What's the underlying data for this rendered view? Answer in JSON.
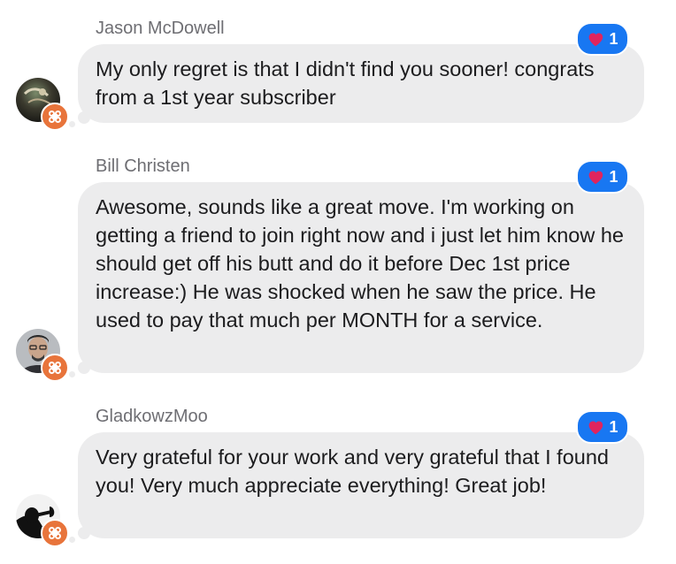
{
  "comments": [
    {
      "author": "Jason McDowell",
      "text": "My only regret is that I didn't find you sooner! congrats from a 1st year subscriber",
      "reaction": {
        "icon": "heart-icon",
        "count": "1"
      },
      "avatar": "avatar-dark-landscape",
      "badge": "app-badge-icon"
    },
    {
      "author": "Bill Christen",
      "text": "Awesome, sounds like a great move. I'm working on getting a friend to join right now and i just let him know he should get off his butt and do it before Dec 1st price increase:) He was shocked when he saw the price. He used to pay that much per MONTH for a service.",
      "reaction": {
        "icon": "heart-icon",
        "count": "1"
      },
      "avatar": "avatar-man-glasses",
      "badge": "app-badge-icon"
    },
    {
      "author": "GladkowzMoo",
      "text": "Very grateful for your work and very grateful that I found you! Very much appreciate everything! Great job!",
      "reaction": {
        "icon": "heart-icon",
        "count": "1"
      },
      "avatar": "avatar-trumpet-silhouette",
      "badge": "app-badge-icon"
    }
  ],
  "colors": {
    "bubble": "#ececed",
    "reaction": "#1877f2",
    "heart": "#e0245e",
    "badge": "#e8743b",
    "author": "#6e6e73",
    "text": "#1c1c1e"
  }
}
